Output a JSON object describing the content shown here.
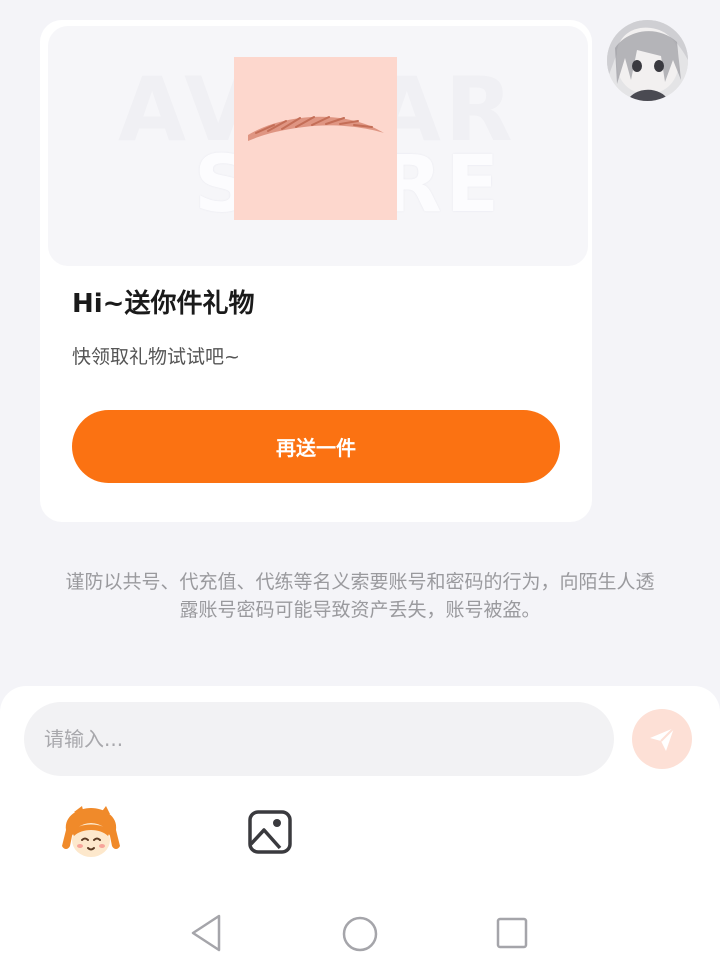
{
  "gift_card": {
    "watermark_line1": "AVATAR",
    "watermark_line2": "STORE",
    "title": "Hi~送你件礼物",
    "subtitle": "快领取礼物试试吧~",
    "button_label": "再送一件"
  },
  "notice": "谨防以共号、代充值、代练等名义索要账号和密码的行为，向陌生人透露账号密码可能导致资产丢失，账号被盗。",
  "input": {
    "placeholder": "请输入..."
  },
  "icons": {
    "send": "send-icon",
    "mascot": "mascot-emoji-icon",
    "image": "image-icon",
    "nav_back": "back-triangle-icon",
    "nav_home": "home-circle-icon",
    "nav_recent": "recent-square-icon"
  },
  "colors": {
    "accent": "#fb7212",
    "send_bg": "#fde0d6",
    "gift_bg": "#fdd7cd"
  }
}
